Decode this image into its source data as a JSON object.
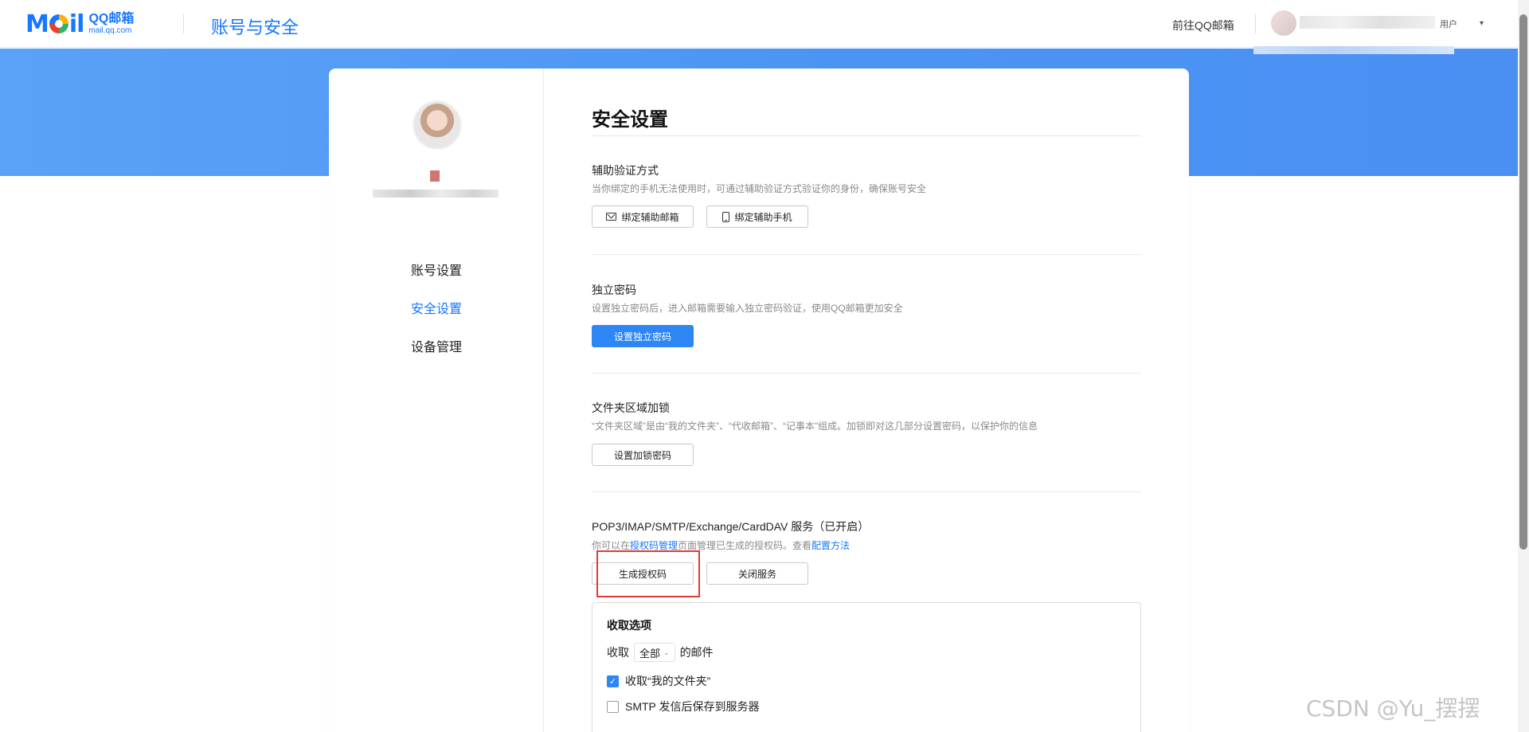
{
  "header": {
    "logo_mail": "M",
    "logo_mail_rest": "il",
    "logo_qq": "QQ邮箱",
    "logo_domain": "mail.qq.com",
    "title": "账号与安全",
    "goto_qq": "前往QQ邮箱",
    "user_suffix": "用户",
    "caret": "▾"
  },
  "sidebar": {
    "items": [
      {
        "label": "账号设置",
        "active": false
      },
      {
        "label": "安全设置",
        "active": true
      },
      {
        "label": "设备管理",
        "active": false
      }
    ]
  },
  "main": {
    "page_title": "安全设置",
    "sections": {
      "aux": {
        "title": "辅助验证方式",
        "desc": "当你绑定的手机无法使用时，可通过辅助验证方式验证你的身份，确保账号安全",
        "btn_email": "绑定辅助邮箱",
        "btn_phone": "绑定辅助手机"
      },
      "pwd": {
        "title": "独立密码",
        "desc": "设置独立密码后，进入邮箱需要输入独立密码验证，使用QQ邮箱更加安全",
        "btn": "设置独立密码"
      },
      "folder": {
        "title": "文件夹区域加锁",
        "desc": "“文件夹区域”是由“我的文件夹”、“代收邮箱”、“记事本”组成。加锁即对这几部分设置密码，以保护你的信息",
        "btn": "设置加锁密码"
      },
      "pop3": {
        "title": "POP3/IMAP/SMTP/Exchange/CardDAV 服务（已开启）",
        "desc_pre": "你可以在",
        "desc_link1": "授权码管理",
        "desc_mid": "页面管理已生成的授权码。查看",
        "desc_link2": "配置方法",
        "btn_gen": "生成授权码",
        "btn_close": "关闭服务"
      }
    },
    "options": {
      "title": "收取选项",
      "receive_pre": "收取",
      "receive_value": "全部",
      "receive_post": "的邮件",
      "cb_folders": "收取“我的文件夹”",
      "cb_folders_checked": true,
      "cb_smtp": "SMTP 发信后保存到服务器",
      "cb_smtp_checked": false,
      "check_mark": "✓"
    }
  },
  "watermark": "CSDN @Yu_摆摆",
  "colors": {
    "accent": "#1677ff",
    "band": "#4b93f4",
    "primary_button": "#2d86f4",
    "highlight": "#e53935"
  }
}
